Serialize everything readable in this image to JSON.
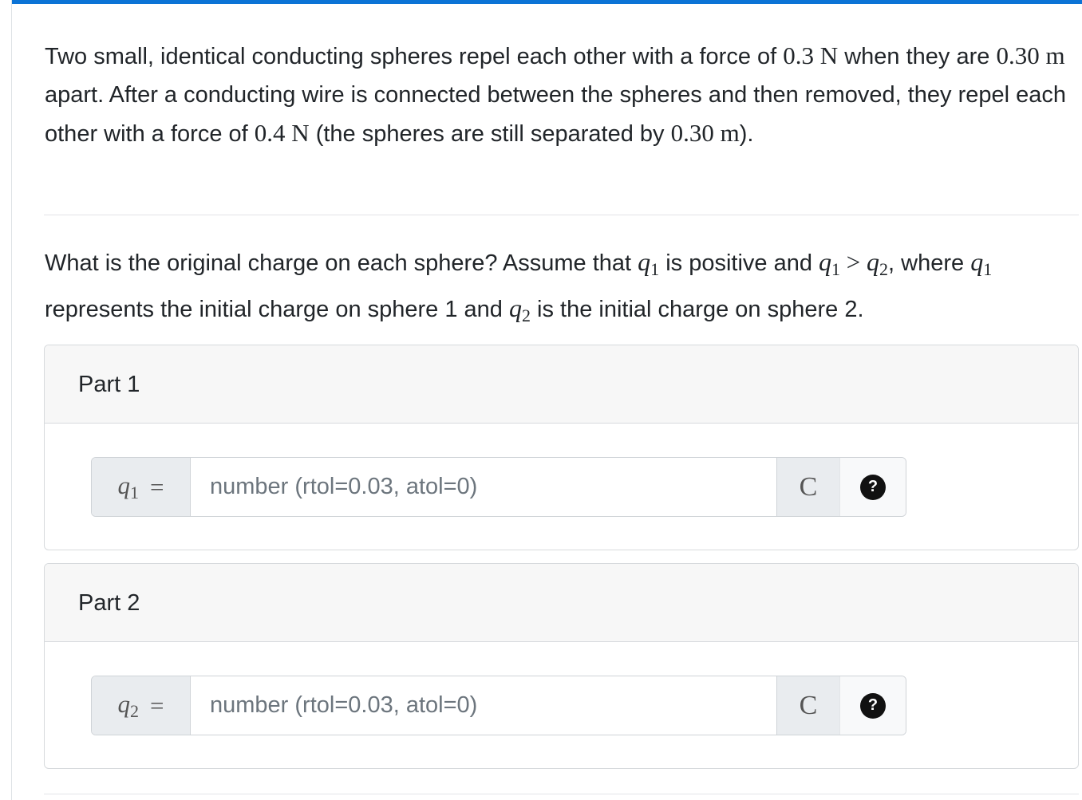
{
  "problem": {
    "intro": {
      "t1": "Two small, identical conducting spheres repel each other with a force of ",
      "m1": "0.3 N",
      "t2": " when they are ",
      "m2": "0.30 m",
      "t3": " apart. After a conducting wire is connected between the spheres and then removed, they repel each other with a force of ",
      "m3": "0.4 N",
      "t4": " (the spheres are still separated by ",
      "m4": "0.30 m",
      "t5": ")."
    },
    "question": {
      "t1": "What is the original charge on each sphere? Assume that ",
      "t2": " is positive and ",
      "gt": " > ",
      "t3": ", where ",
      "t4": " represents the initial charge on sphere 1 and ",
      "t5": " is the initial charge on sphere 2.",
      "var_q": "q",
      "sub1": "1",
      "sub2": "2"
    }
  },
  "parts": [
    {
      "title": "Part 1",
      "var": "q",
      "sub": "1",
      "equals": "=",
      "placeholder": "number (rtol=0.03, atol=0)",
      "value": "",
      "unit": "C",
      "help": "?"
    },
    {
      "title": "Part 2",
      "var": "q",
      "sub": "2",
      "equals": "=",
      "placeholder": "number (rtol=0.03, atol=0)",
      "value": "",
      "unit": "C",
      "help": "?"
    }
  ],
  "colors": {
    "accent": "#0b73d6",
    "header_bg": "#f7f7f7",
    "addon_bg": "#e9ecef"
  }
}
